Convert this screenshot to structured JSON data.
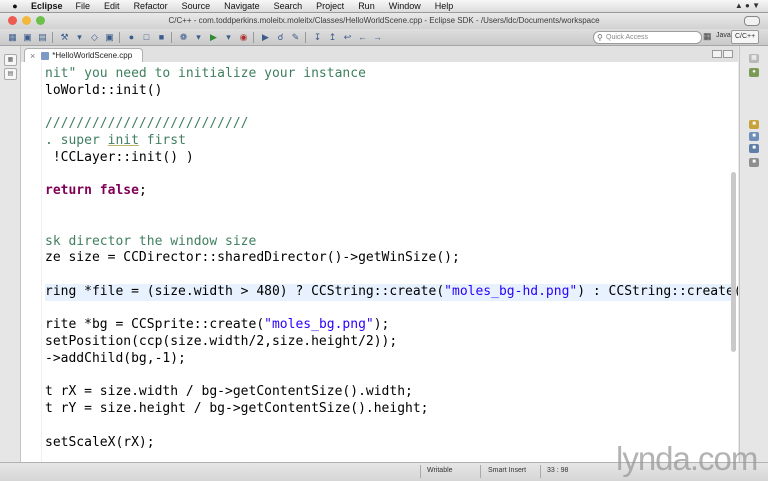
{
  "menubar": {
    "app_name": "Eclipse",
    "items": [
      "File",
      "Edit",
      "Refactor",
      "Source",
      "Navigate",
      "Search",
      "Project",
      "Run",
      "Window",
      "Help"
    ]
  },
  "window": {
    "title": "C/C++ - com.toddperkins.moleitx.moleitx/Classes/HelloWorldScene.cpp - Eclipse SDK - /Users/ldc/Documents/workspace"
  },
  "toolbar": {
    "quick_access_placeholder": "Quick Access",
    "perspectives": [
      "Java",
      "C/C++"
    ]
  },
  "editor": {
    "tab_label": "*HelloWorldScene.cpp",
    "lines": [
      {
        "parts": [
          {
            "t": "nit\" you need to initialize your instance",
            "c": "cmt"
          }
        ],
        "style": "cmt"
      },
      {
        "parts": [
          {
            "t": "loWorld::init()",
            "c": ""
          }
        ],
        "style": ""
      },
      {
        "parts": [
          {
            "t": " ",
            "c": ""
          }
        ],
        "style": ""
      },
      {
        "parts": [
          {
            "t": "//////////////////////////",
            "c": "cmt"
          }
        ],
        "style": "cmt"
      },
      {
        "parts": [
          {
            "t": ". super ",
            "c": "cmt"
          },
          {
            "t": "init",
            "c": "ul"
          },
          {
            "t": " first",
            "c": "cmt"
          }
        ],
        "style": "cmt"
      },
      {
        "parts": [
          {
            "t": " !CCLayer::init() )",
            "c": ""
          }
        ],
        "style": ""
      },
      {
        "parts": [
          {
            "t": " ",
            "c": ""
          }
        ],
        "style": ""
      },
      {
        "parts": [
          {
            "t": "return",
            "c": "kw"
          },
          {
            "t": " ",
            "c": ""
          },
          {
            "t": "false",
            "c": "kw"
          },
          {
            "t": ";",
            "c": ""
          }
        ],
        "style": ""
      },
      {
        "parts": [
          {
            "t": " ",
            "c": ""
          }
        ],
        "style": ""
      },
      {
        "parts": [
          {
            "t": " ",
            "c": ""
          }
        ],
        "style": ""
      },
      {
        "parts": [
          {
            "t": "sk director the window size",
            "c": "cmt"
          }
        ],
        "style": "cmt"
      },
      {
        "parts": [
          {
            "t": "ze size = CCDirector::sharedDirector()->getWinSize();",
            "c": ""
          }
        ],
        "style": ""
      },
      {
        "parts": [
          {
            "t": " ",
            "c": ""
          }
        ],
        "style": ""
      },
      {
        "parts": [
          {
            "t": "ring *file = (size.width > 480) ? CCString::create(",
            "c": ""
          },
          {
            "t": "\"moles_bg-hd.png\"",
            "c": "str"
          },
          {
            "t": ") : CCString::create(",
            "c": ""
          },
          {
            "t": "CARET",
            "c": "caret"
          },
          {
            "t": ")",
            "c": ""
          }
        ],
        "style": "cur"
      },
      {
        "parts": [
          {
            "t": " ",
            "c": ""
          }
        ],
        "style": ""
      },
      {
        "parts": [
          {
            "t": "rite *bg = CCSprite::create(",
            "c": ""
          },
          {
            "t": "\"moles_bg.png\"",
            "c": "str"
          },
          {
            "t": ");",
            "c": ""
          }
        ],
        "style": ""
      },
      {
        "parts": [
          {
            "t": "setPosition(ccp(size.width/2,size.height/2));",
            "c": ""
          }
        ],
        "style": ""
      },
      {
        "parts": [
          {
            "t": "->addChild(bg,-1);",
            "c": ""
          }
        ],
        "style": ""
      },
      {
        "parts": [
          {
            "t": " ",
            "c": ""
          }
        ],
        "style": ""
      },
      {
        "parts": [
          {
            "t": "t rX = size.width / bg->getContentSize().width;",
            "c": ""
          }
        ],
        "style": ""
      },
      {
        "parts": [
          {
            "t": "t rY = size.height / bg->getContentSize().height;",
            "c": ""
          }
        ],
        "style": ""
      },
      {
        "parts": [
          {
            "t": " ",
            "c": ""
          }
        ],
        "style": ""
      },
      {
        "parts": [
          {
            "t": "setScaleX(rX);",
            "c": ""
          }
        ],
        "style": ""
      }
    ]
  },
  "statusbar": {
    "mode": "Writable",
    "insert_mode": "Smart Insert",
    "position": "33 : 98"
  },
  "watermark": {
    "text": "lynda.com"
  }
}
